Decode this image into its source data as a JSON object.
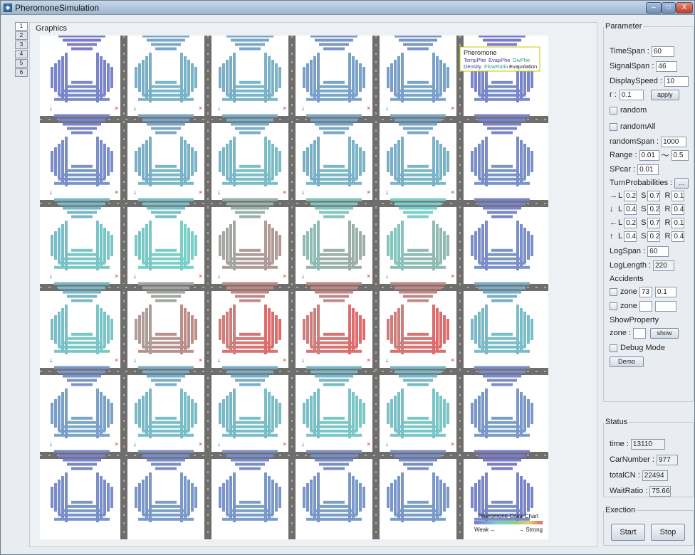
{
  "window": {
    "title": "PheromoneSimulation",
    "min": "–",
    "max": "□",
    "close": "X"
  },
  "tabs": [
    "1",
    "2",
    "3",
    "4",
    "5",
    "6"
  ],
  "graphics": {
    "label": "Graphics",
    "legend": {
      "heading": "Pheromone",
      "line1a": "TempPhe",
      "line1b": "EvapPhe",
      "line1c": "DivPhe",
      "line2a": "Density",
      "line2b": "FlowRatio",
      "line2c": "Evapolation"
    },
    "colorchart": {
      "title": "Pheromone Color Chart",
      "weak": "Weak ←",
      "strong": "→ Strong"
    },
    "colors": {
      "road": "#6e6e6e",
      "stripe": "#f2e9a0",
      "low": "#7a7cc9",
      "mid": "#7ad0c6",
      "high": "#e06a6a",
      "stop": "#d32020",
      "arrow": "#1e3ea8"
    },
    "pheromone_levels": [
      [
        0.05,
        0.3,
        0.3,
        0.2,
        0.2,
        0.05
      ],
      [
        0.1,
        0.3,
        0.35,
        0.3,
        0.3,
        0.1
      ],
      [
        0.4,
        0.45,
        0.7,
        0.6,
        0.55,
        0.1
      ],
      [
        0.4,
        0.75,
        0.9,
        0.9,
        0.9,
        0.35
      ],
      [
        0.2,
        0.35,
        0.35,
        0.4,
        0.4,
        0.15
      ],
      [
        0.1,
        0.15,
        0.15,
        0.15,
        0.15,
        0.05
      ]
    ]
  },
  "parameter": {
    "legend": "Parameter",
    "timespan": {
      "label": "TimeSpan :",
      "value": "60"
    },
    "signalspan": {
      "label": "SignalSpan :",
      "value": "46"
    },
    "displayspeed": {
      "label": "DisplaySpeed :",
      "value": "10"
    },
    "r": {
      "label": "r :",
      "value": "0.1",
      "button": "apply"
    },
    "random": "random",
    "randomall": "randomAll",
    "randomspan": {
      "label": "randomSpan :",
      "value": "1000"
    },
    "range": {
      "label": "Range :",
      "min": "0.01",
      "sep": "〜",
      "max": "0.5"
    },
    "spcar": {
      "label": "SPcar :",
      "value": "0.01"
    },
    "turn": {
      "label": "TurnProbabilities :",
      "button": "..."
    },
    "turnrows": [
      {
        "dir": "→",
        "L": "0.2",
        "S": "0.7",
        "R": "0.1"
      },
      {
        "dir": "↓",
        "L": "0.4",
        "S": "0.2",
        "R": "0.4"
      },
      {
        "dir": "←",
        "L": "0.2",
        "S": "0.7",
        "R": "0.1"
      },
      {
        "dir": "↑",
        "L": "0.4",
        "S": "0.2",
        "R": "0.4"
      }
    ],
    "letters": {
      "l": "L",
      "s": "S",
      "r": "R"
    },
    "logspan": {
      "label": "LogSpan :",
      "value": "60"
    },
    "loglength": {
      "label": "LogLength :",
      "value": "220"
    },
    "accidents": {
      "label": "Accidents",
      "zone_label": "zone",
      "zone1": "73",
      "zone1b": "0.1",
      "zone2": "",
      "zone2b": ""
    },
    "showproperty": {
      "label": "ShowProperty",
      "zone_label": "zone :",
      "zone": "",
      "button": "show"
    },
    "debug": "Debug Mode",
    "demo": "Demo"
  },
  "status": {
    "legend": "Status",
    "time": {
      "label": "time :",
      "value": "13110"
    },
    "carnumber": {
      "label": "CarNumber :",
      "value": "977"
    },
    "totalcn": {
      "label": "totalCN :",
      "value": "22494"
    },
    "waitratio": {
      "label": "WaitRatio :",
      "value": "75.66"
    }
  },
  "exection": {
    "legend": "Exection",
    "start": "Start",
    "stop": "Stop"
  }
}
